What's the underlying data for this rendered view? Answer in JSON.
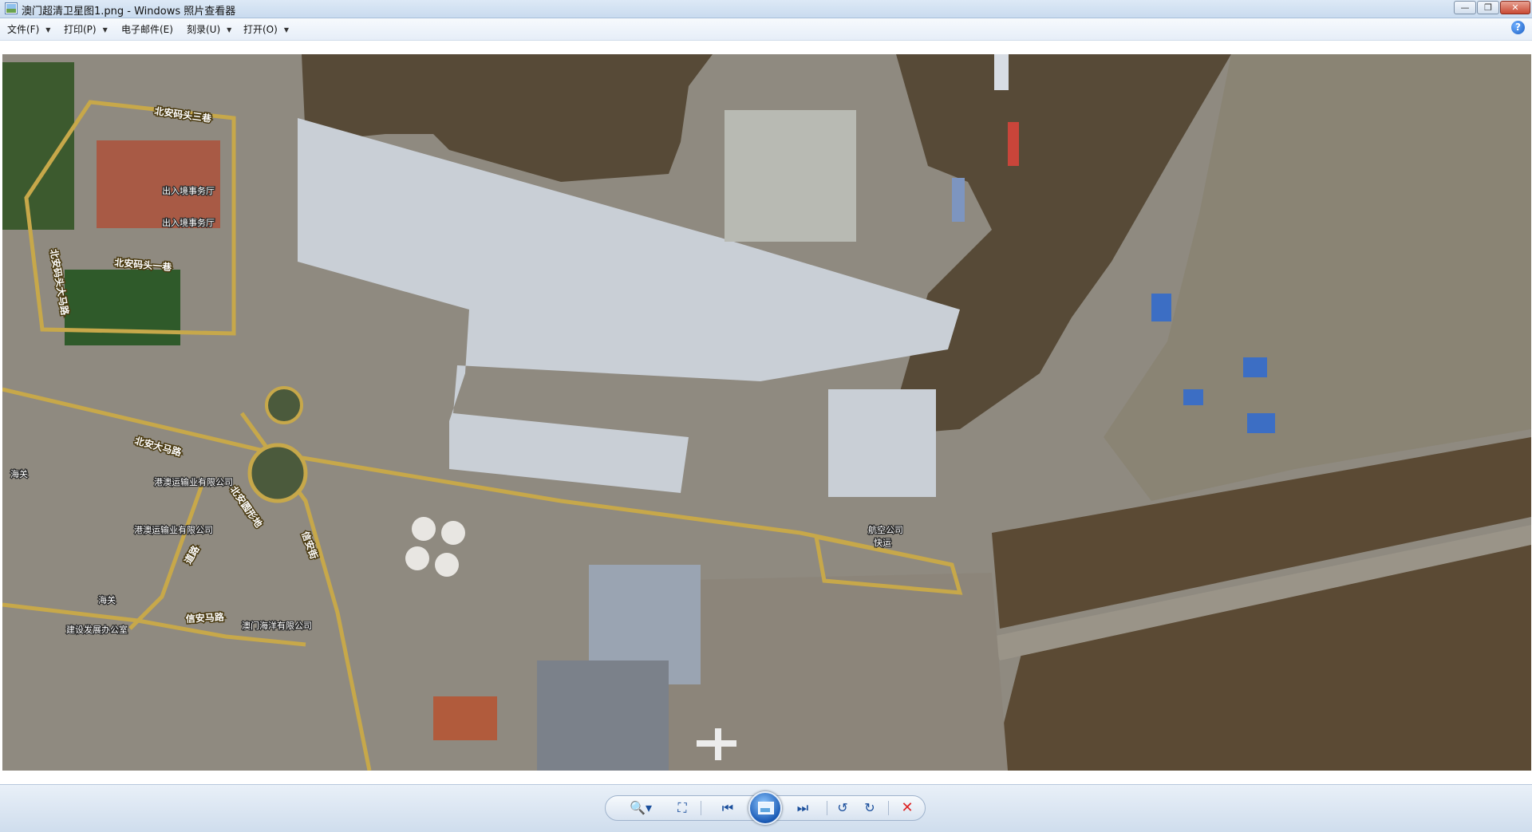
{
  "window": {
    "title": "澳门超清卫星图1.png - Windows 照片查看器",
    "minimize_glyph": "—",
    "maximize_glyph": "❐",
    "close_glyph": "✕"
  },
  "menu": {
    "items": [
      {
        "label": "文件(F)"
      },
      {
        "label": "打印(P)"
      },
      {
        "label": "电子邮件(E)"
      },
      {
        "label": "刻录(U)"
      },
      {
        "label": "打开(O)"
      }
    ],
    "help_glyph": "?"
  },
  "map": {
    "road_labels": [
      "北安码头三巷",
      "北安码头一巷",
      "北安大马路",
      "北安码头大马路",
      "北安圆形地",
      "信安马路",
      "信安街",
      "道路"
    ],
    "place_labels": [
      "出入境事务厅",
      "出入境事务厅",
      "海关",
      "港澳运输业有限公司",
      "港澳运输业有限公司",
      "建设发展办公室",
      "澳门海洋有限公司",
      "海关",
      "航空公司",
      "快运"
    ]
  },
  "toolbar": {
    "zoom_glyph": "🔍▾",
    "fit_glyph": "⛶",
    "prev_glyph": "⏮",
    "next_glyph": "⏭",
    "rotate_left_glyph": "↺",
    "rotate_right_glyph": "↻",
    "delete_glyph": "✕"
  },
  "colors": {
    "water": "#574a37",
    "roof": "#c9cfd6",
    "road": "#c7a84a",
    "vegetation": "#2f5a2a",
    "delete": "#dd2222"
  }
}
